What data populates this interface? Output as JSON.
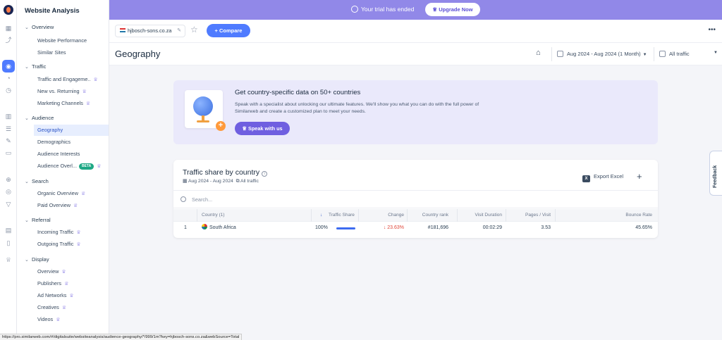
{
  "banner": {
    "trial_text": "Your trial has ended",
    "upgrade_label": "Upgrade Now"
  },
  "sidebar": {
    "title": "Website Analysis",
    "sections": [
      {
        "label": "Overview",
        "items": [
          {
            "label": "Website Performance",
            "crown": false
          },
          {
            "label": "Similar Sites",
            "crown": false
          }
        ]
      },
      {
        "label": "Traffic",
        "items": [
          {
            "label": "Traffic and Engageme..",
            "crown": true
          },
          {
            "label": "New vs. Returning",
            "crown": true
          },
          {
            "label": "Marketing Channels",
            "crown": true
          }
        ]
      },
      {
        "label": "Audience",
        "items": [
          {
            "label": "Geography",
            "crown": false,
            "active": true
          },
          {
            "label": "Demographics",
            "crown": false
          },
          {
            "label": "Audience Interests",
            "crown": false
          },
          {
            "label": "Audience Overl...",
            "crown": true,
            "badge": "BETA"
          }
        ]
      },
      {
        "label": "Search",
        "items": [
          {
            "label": "Organic Overview",
            "crown": true
          },
          {
            "label": "Paid Overview",
            "crown": true
          }
        ]
      },
      {
        "label": "Referral",
        "items": [
          {
            "label": "Incoming Traffic",
            "crown": true
          },
          {
            "label": "Outgoing Traffic",
            "crown": true
          }
        ]
      },
      {
        "label": "Display",
        "items": [
          {
            "label": "Overview",
            "crown": true
          },
          {
            "label": "Publishers",
            "crown": true
          },
          {
            "label": "Ad Networks",
            "crown": true
          },
          {
            "label": "Creatives",
            "crown": true
          },
          {
            "label": "Videos",
            "crown": true
          }
        ]
      }
    ]
  },
  "toolbar": {
    "domain": "hjbosch-sons.co.za",
    "compare_label": "+ Compare",
    "more": "•••"
  },
  "header": {
    "title": "Geography",
    "date_range": "Aug 2024 - Aug 2024 (1 Month)",
    "traffic_filter": "All traffic"
  },
  "promo": {
    "title": "Get country-specific data on 50+ countries",
    "body": "Speak with a specialist about unlocking our ultimate features. We'll show you what you can do with the full power of Similarweb and create a customized plan to meet your needs.",
    "button_label": "Speak with us",
    "plus": "+"
  },
  "table_card": {
    "title": "Traffic share by country",
    "info": "i",
    "date_range": "Aug 2024 - Aug 2024",
    "traffic": "All traffic",
    "export_label": "Export Excel",
    "xl_glyph": "X",
    "add_glyph": "+",
    "search_placeholder": "Search...",
    "columns": [
      "Country (1)",
      "Traffic Share",
      "Change",
      "Country rank",
      "Visit Duration",
      "Pages / Visit",
      "Bounce Rate"
    ],
    "sort_arrow": "↓",
    "rows": [
      {
        "index": "1",
        "country": "South Africa",
        "traffic_share": "100%",
        "traffic_share_fraction": 1.0,
        "change": "↓ 23.63%",
        "rank": "#181,696",
        "visit_duration": "00:02:29",
        "pages_per_visit": "3.53",
        "bounce_rate": "45.65%"
      }
    ]
  },
  "feedback_label": "Feedback",
  "status_url": "https://pro.similarweb.com/#/digitalsuite/websiteanalysis/audience-geography/*/999/1m?key=hjbosch-sons.co.za&webSource=Total",
  "icons": {
    "rail": [
      "grid-icon",
      "trend-icon",
      "globe-icon",
      "pie-icon",
      "clock-icon",
      "building-icon",
      "list-icon",
      "edit-icon",
      "chat-icon",
      "web-icon",
      "target-icon",
      "funnel-icon",
      "doc-icon",
      "phone-icon",
      "crown-icon"
    ]
  },
  "colors": {
    "accent": "#4f7bff",
    "banner": "#9188e8",
    "promo_bg": "#eae9fb",
    "negative": "#e0473a",
    "crown": "#7a6be0"
  }
}
